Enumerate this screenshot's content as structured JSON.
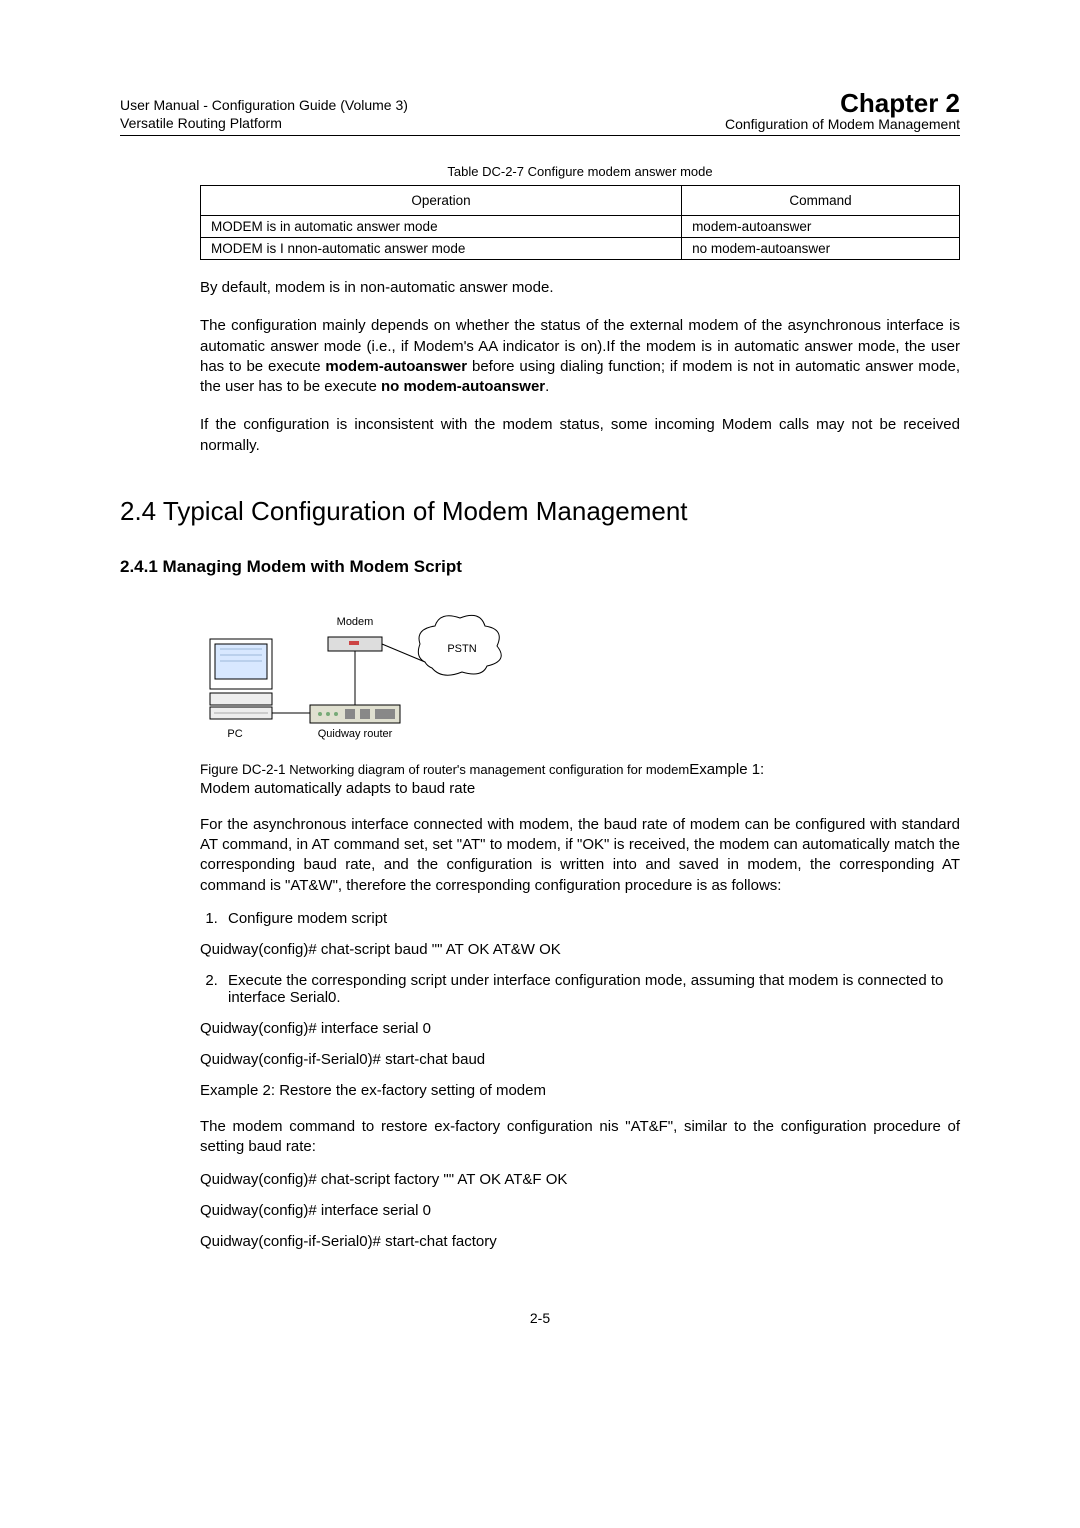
{
  "header": {
    "left1": "User Manual - Configuration Guide (Volume 3)",
    "left2": "Versatile Routing Platform",
    "rightTitle": "Chapter 2",
    "rightSub": "Configuration of Modem Management"
  },
  "table": {
    "captionPrefix": "Table DC-2-7 ",
    "caption": "Configure modem answer mode",
    "h1": "Operation",
    "h2": "Command",
    "r1c1": "MODEM is in automatic answer mode",
    "r1c2": " modem-autoanswer",
    "r2c1": "MODEM is I nnon-automatic answer mode",
    "r2c2": "no  modem-autoanswer"
  },
  "p1": "By default, modem is in non-automatic answer mode.",
  "p2a": "The configuration mainly depends on whether the status of the external modem of the asynchronous interface is automatic answer mode (i.e., if Modem's AA indicator is on).If the modem is in automatic answer mode, the user has to be execute ",
  "p2b": "modem-autoanswer",
  "p2c": " before using dialing function; if modem is not in automatic answer mode, the user has to be execute ",
  "p2d": "no modem-autoanswer",
  "p2e": ".",
  "p3": "If the configuration is inconsistent with the modem status, some incoming Modem calls may not be received normally.",
  "h2": "2.4  Typical Configuration of Modem Management",
  "h3": "2.4.1  Managing Modem with Modem Script",
  "diagram": {
    "modem": "Modem",
    "pstn": "PSTN",
    "pc": "PC",
    "router": "Quidway router"
  },
  "figcapPrefix": "Figure DC-2-1 ",
  "figcap": "Networking diagram of router's management configuration for modem",
  "ex1label": "Example 1:",
  "ex1title": "Modem automatically adapts to baud rate",
  "p4": "For the asynchronous interface connected with modem, the baud rate of modem can be configured with standard AT command, in AT command set, set \"AT\" to modem, if \"OK\" is received, the modem can automatically match the corresponding baud rate, and the configuration is written into and saved in modem, the corresponding AT command is \"AT&W\", therefore the corresponding configuration procedure is as follows:",
  "step1": "Configure modem script",
  "cmd1": "Quidway(config)# chat-script baud \"\" AT OK AT&W OK",
  "step2": "Execute the corresponding script under interface configuration mode, assuming that modem is connected to interface Serial0.",
  "cmd2": "Quidway(config)# interface serial 0",
  "cmd3": "Quidway(config-if-Serial0)# start-chat baud",
  "ex2": "Example 2: Restore the ex-factory setting of modem",
  "p5": "The modem command to restore ex-factory configuration nis \"AT&F\", similar to the configuration procedure of setting baud rate:",
  "cmd4": "Quidway(config)# chat-script factory \"\" AT OK AT&F OK",
  "cmd5": "Quidway(config)# interface serial 0",
  "cmd6": "Quidway(config-if-Serial0)# start-chat factory",
  "pagenum": "2-5"
}
